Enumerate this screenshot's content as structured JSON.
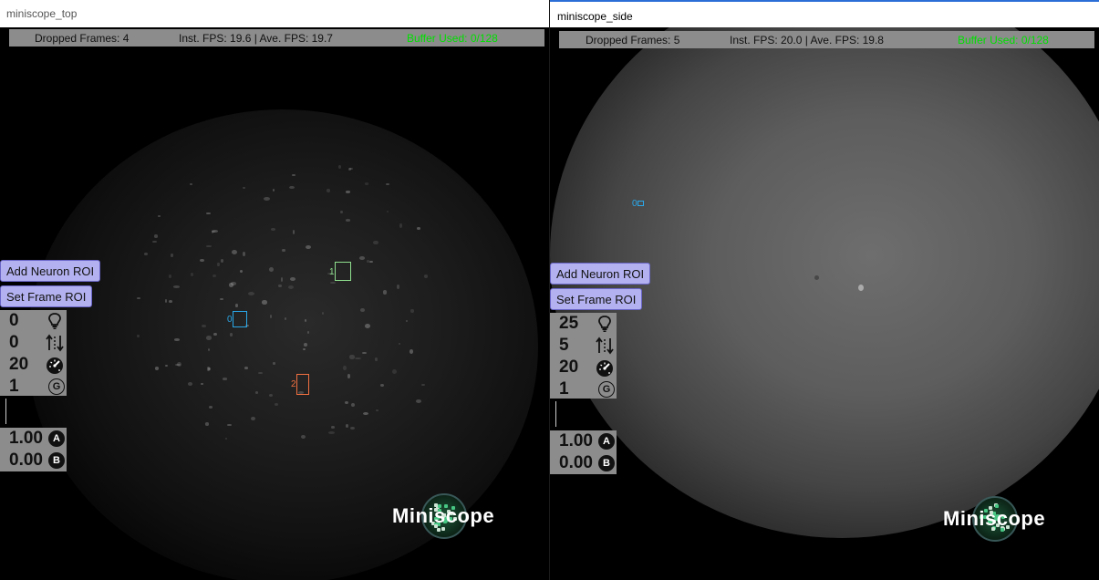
{
  "windows": [
    {
      "title": "miniscope_top",
      "status": {
        "dropped": "Dropped Frames: 4",
        "fps": "Inst. FPS: 19.6 | Ave. FPS: 19.7",
        "buffer": "Buffer Used: 0/128"
      },
      "buttons": {
        "add_roi": "Add Neuron ROI",
        "set_frame": "Set Frame ROI"
      },
      "params": {
        "led": "0",
        "focus": "0",
        "fps": "20",
        "gain": "1"
      },
      "display": {
        "a": "1.00",
        "b": "0.00"
      },
      "rois": [
        {
          "label": "0",
          "color": "#2aa7e8"
        },
        {
          "label": "1",
          "color": "#8fe08f"
        },
        {
          "label": "2",
          "color": "#f07040"
        }
      ],
      "logo": "Miniscope"
    },
    {
      "title": "miniscope_side",
      "status": {
        "dropped": "Dropped Frames: 5",
        "fps": "Inst. FPS: 20.0 | Ave. FPS: 19.8",
        "buffer": "Buffer Used: 0/128"
      },
      "buttons": {
        "add_roi": "Add Neuron ROI",
        "set_frame": "Set Frame ROI"
      },
      "params": {
        "led": "25",
        "focus": "5",
        "fps": "20",
        "gain": "1"
      },
      "display": {
        "a": "1.00",
        "b": "0.00"
      },
      "rois": [
        {
          "label": "0",
          "color": "#2aa7e8"
        }
      ],
      "logo": "Miniscope"
    }
  ],
  "icons": {
    "led": "lightbulb-icon",
    "focus": "focus-arrows-icon",
    "fps": "speedometer-icon",
    "gain": "gain-g-icon",
    "a": "a-circle-icon",
    "b": "b-circle-icon"
  },
  "colors": {
    "status_green": "#00e000",
    "button_bg": "#b3b1ef",
    "panel_bg": "#8c8c8c"
  }
}
